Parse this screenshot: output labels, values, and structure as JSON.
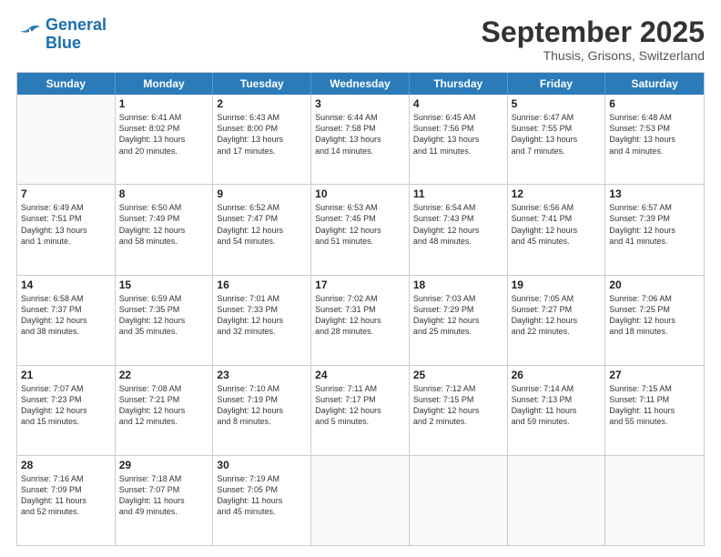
{
  "logo": {
    "line1": "General",
    "line2": "Blue"
  },
  "title": "September 2025",
  "location": "Thusis, Grisons, Switzerland",
  "header_days": [
    "Sunday",
    "Monday",
    "Tuesday",
    "Wednesday",
    "Thursday",
    "Friday",
    "Saturday"
  ],
  "weeks": [
    [
      {
        "day": "",
        "info": ""
      },
      {
        "day": "1",
        "info": "Sunrise: 6:41 AM\nSunset: 8:02 PM\nDaylight: 13 hours\nand 20 minutes."
      },
      {
        "day": "2",
        "info": "Sunrise: 6:43 AM\nSunset: 8:00 PM\nDaylight: 13 hours\nand 17 minutes."
      },
      {
        "day": "3",
        "info": "Sunrise: 6:44 AM\nSunset: 7:58 PM\nDaylight: 13 hours\nand 14 minutes."
      },
      {
        "day": "4",
        "info": "Sunrise: 6:45 AM\nSunset: 7:56 PM\nDaylight: 13 hours\nand 11 minutes."
      },
      {
        "day": "5",
        "info": "Sunrise: 6:47 AM\nSunset: 7:55 PM\nDaylight: 13 hours\nand 7 minutes."
      },
      {
        "day": "6",
        "info": "Sunrise: 6:48 AM\nSunset: 7:53 PM\nDaylight: 13 hours\nand 4 minutes."
      }
    ],
    [
      {
        "day": "7",
        "info": "Sunrise: 6:49 AM\nSunset: 7:51 PM\nDaylight: 13 hours\nand 1 minute."
      },
      {
        "day": "8",
        "info": "Sunrise: 6:50 AM\nSunset: 7:49 PM\nDaylight: 12 hours\nand 58 minutes."
      },
      {
        "day": "9",
        "info": "Sunrise: 6:52 AM\nSunset: 7:47 PM\nDaylight: 12 hours\nand 54 minutes."
      },
      {
        "day": "10",
        "info": "Sunrise: 6:53 AM\nSunset: 7:45 PM\nDaylight: 12 hours\nand 51 minutes."
      },
      {
        "day": "11",
        "info": "Sunrise: 6:54 AM\nSunset: 7:43 PM\nDaylight: 12 hours\nand 48 minutes."
      },
      {
        "day": "12",
        "info": "Sunrise: 6:56 AM\nSunset: 7:41 PM\nDaylight: 12 hours\nand 45 minutes."
      },
      {
        "day": "13",
        "info": "Sunrise: 6:57 AM\nSunset: 7:39 PM\nDaylight: 12 hours\nand 41 minutes."
      }
    ],
    [
      {
        "day": "14",
        "info": "Sunrise: 6:58 AM\nSunset: 7:37 PM\nDaylight: 12 hours\nand 38 minutes."
      },
      {
        "day": "15",
        "info": "Sunrise: 6:59 AM\nSunset: 7:35 PM\nDaylight: 12 hours\nand 35 minutes."
      },
      {
        "day": "16",
        "info": "Sunrise: 7:01 AM\nSunset: 7:33 PM\nDaylight: 12 hours\nand 32 minutes."
      },
      {
        "day": "17",
        "info": "Sunrise: 7:02 AM\nSunset: 7:31 PM\nDaylight: 12 hours\nand 28 minutes."
      },
      {
        "day": "18",
        "info": "Sunrise: 7:03 AM\nSunset: 7:29 PM\nDaylight: 12 hours\nand 25 minutes."
      },
      {
        "day": "19",
        "info": "Sunrise: 7:05 AM\nSunset: 7:27 PM\nDaylight: 12 hours\nand 22 minutes."
      },
      {
        "day": "20",
        "info": "Sunrise: 7:06 AM\nSunset: 7:25 PM\nDaylight: 12 hours\nand 18 minutes."
      }
    ],
    [
      {
        "day": "21",
        "info": "Sunrise: 7:07 AM\nSunset: 7:23 PM\nDaylight: 12 hours\nand 15 minutes."
      },
      {
        "day": "22",
        "info": "Sunrise: 7:08 AM\nSunset: 7:21 PM\nDaylight: 12 hours\nand 12 minutes."
      },
      {
        "day": "23",
        "info": "Sunrise: 7:10 AM\nSunset: 7:19 PM\nDaylight: 12 hours\nand 8 minutes."
      },
      {
        "day": "24",
        "info": "Sunrise: 7:11 AM\nSunset: 7:17 PM\nDaylight: 12 hours\nand 5 minutes."
      },
      {
        "day": "25",
        "info": "Sunrise: 7:12 AM\nSunset: 7:15 PM\nDaylight: 12 hours\nand 2 minutes."
      },
      {
        "day": "26",
        "info": "Sunrise: 7:14 AM\nSunset: 7:13 PM\nDaylight: 11 hours\nand 59 minutes."
      },
      {
        "day": "27",
        "info": "Sunrise: 7:15 AM\nSunset: 7:11 PM\nDaylight: 11 hours\nand 55 minutes."
      }
    ],
    [
      {
        "day": "28",
        "info": "Sunrise: 7:16 AM\nSunset: 7:09 PM\nDaylight: 11 hours\nand 52 minutes."
      },
      {
        "day": "29",
        "info": "Sunrise: 7:18 AM\nSunset: 7:07 PM\nDaylight: 11 hours\nand 49 minutes."
      },
      {
        "day": "30",
        "info": "Sunrise: 7:19 AM\nSunset: 7:05 PM\nDaylight: 11 hours\nand 45 minutes."
      },
      {
        "day": "",
        "info": ""
      },
      {
        "day": "",
        "info": ""
      },
      {
        "day": "",
        "info": ""
      },
      {
        "day": "",
        "info": ""
      }
    ]
  ]
}
